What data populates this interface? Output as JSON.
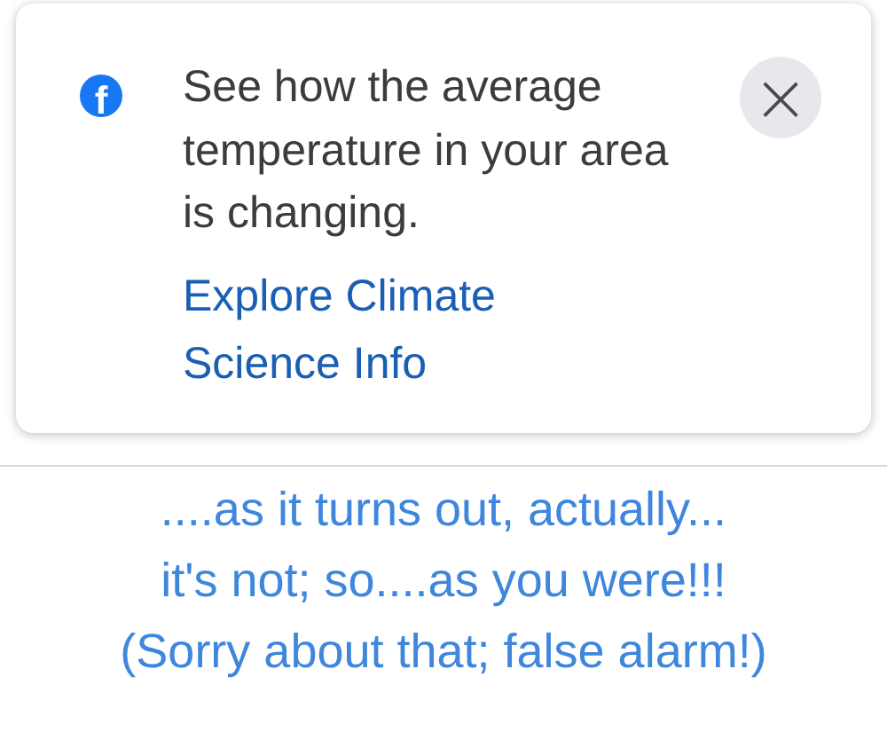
{
  "notification": {
    "logo": "f",
    "message": "See how the average temperature in your area is changing.",
    "link": "Explore Climate Science Info",
    "close": "×"
  },
  "caption": [
    "....as it turns out, actually...",
    "it's not; so....as you were!!!",
    "(Sorry about that; false alarm!)"
  ]
}
